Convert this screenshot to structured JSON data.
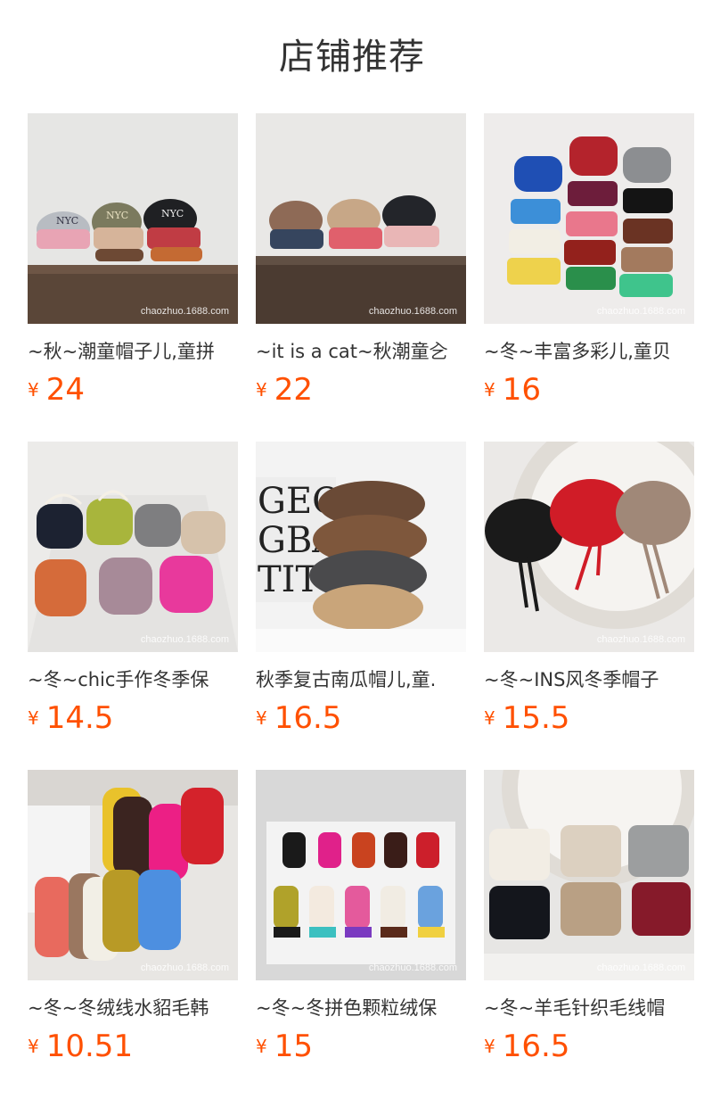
{
  "page": {
    "title": "店铺推荐"
  },
  "products": [
    {
      "name": "~秋~潮童帽子儿,童拼",
      "currency": "¥",
      "price": "24",
      "watermark": "chaozhuo.1688.com"
    },
    {
      "name": "~it is a cat~秋潮童㐈",
      "currency": "¥",
      "price": "22",
      "watermark": "chaozhuo.1688.com"
    },
    {
      "name": "~冬~丰富多彩儿,童贝",
      "currency": "¥",
      "price": "16",
      "watermark": "chaozhuo.1688.com"
    },
    {
      "name": "~冬~chic手作冬季保",
      "currency": "¥",
      "price": "14.5",
      "watermark": "chaozhuo.1688.com"
    },
    {
      "name": "秋季复古南瓜帽儿,童.",
      "currency": "¥",
      "price": "16.5",
      "watermark": ""
    },
    {
      "name": "~冬~INS风冬季帽子",
      "currency": "¥",
      "price": "15.5",
      "watermark": "chaozhuo.1688.com"
    },
    {
      "name": "~冬~冬绒线水貂毛韩",
      "currency": "¥",
      "price": "10.51",
      "watermark": "chaozhuo.1688.com"
    },
    {
      "name": "~冬~冬拼色颗粒绒保",
      "currency": "¥",
      "price": "15",
      "watermark": "chaozhuo.1688.com"
    },
    {
      "name": "~冬~羊毛针织毛线帽",
      "currency": "¥",
      "price": "16.5",
      "watermark": "chaozhuo.1688.com"
    }
  ],
  "colors": {
    "price": "#ff5000",
    "text": "#333333"
  }
}
